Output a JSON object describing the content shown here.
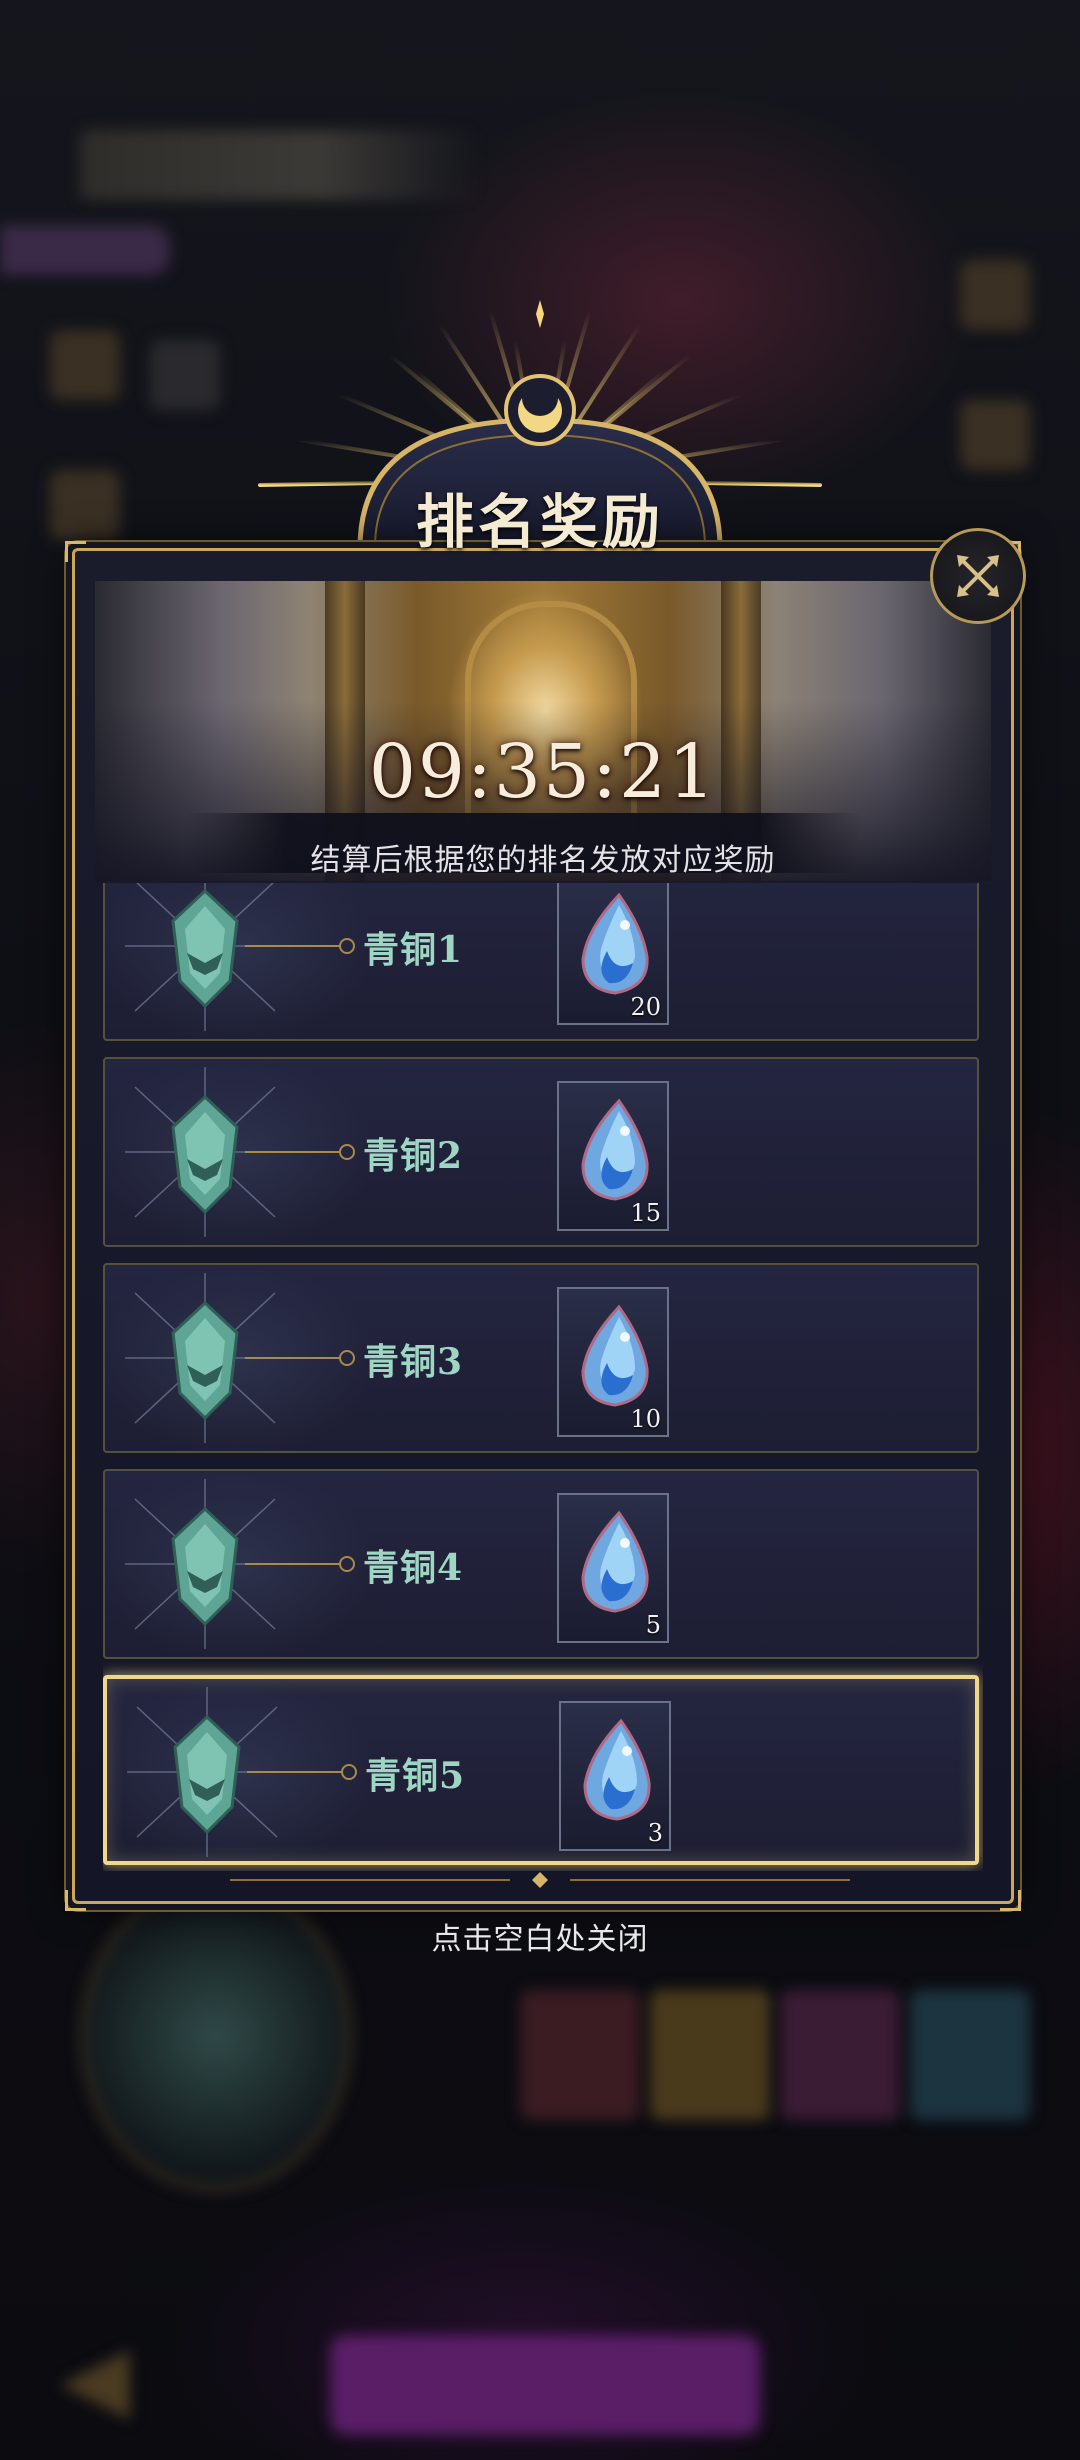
{
  "dialog": {
    "title": "排名奖励",
    "countdown": "09:35:21",
    "note": "结算后根据您的排名发放对应奖励",
    "dismiss_hint": "点击空白处关闭",
    "close_icon": "close-cross-icon"
  },
  "rewards": [
    {
      "rank": "青铜1",
      "count": "20",
      "item_icon": "blue-gem-icon",
      "selected": false
    },
    {
      "rank": "青铜2",
      "count": "15",
      "item_icon": "blue-gem-icon",
      "selected": false
    },
    {
      "rank": "青铜3",
      "count": "10",
      "item_icon": "blue-gem-icon",
      "selected": false
    },
    {
      "rank": "青铜4",
      "count": "5",
      "item_icon": "blue-gem-icon",
      "selected": false
    },
    {
      "rank": "青铜5",
      "count": "3",
      "item_icon": "blue-gem-icon",
      "selected": true
    }
  ],
  "colors": {
    "gold": "#c9a85a",
    "highlight": "#f0d78a",
    "rank_text": "#9fd6c3",
    "panel": "#1d1e33"
  }
}
